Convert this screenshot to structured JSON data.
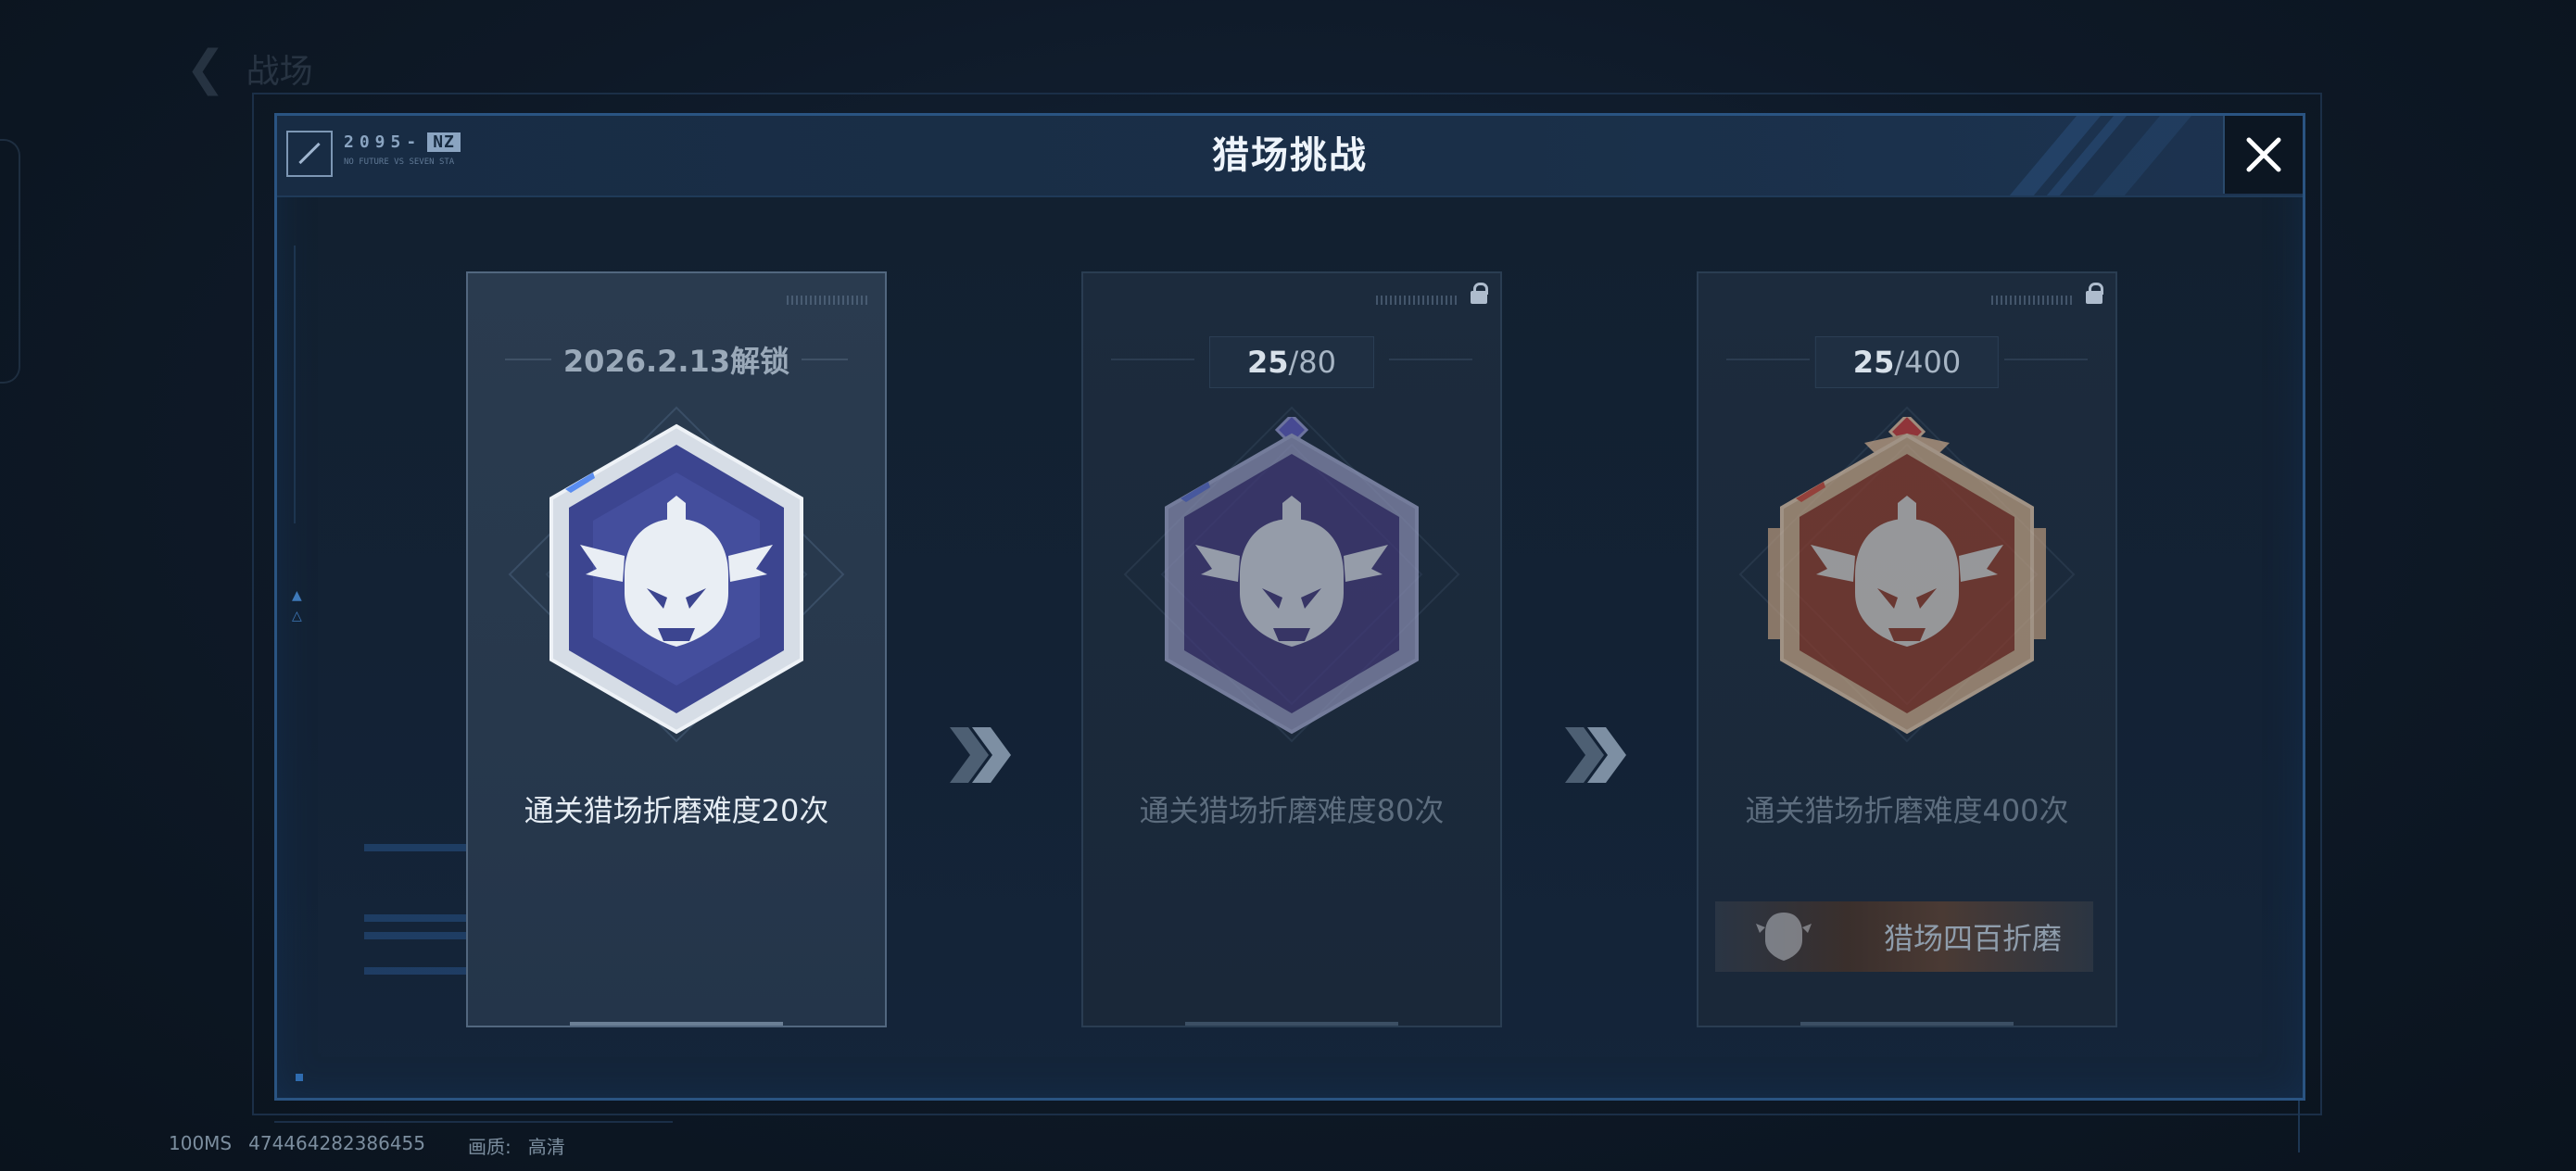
{
  "background": {
    "back_label": "战场"
  },
  "modal": {
    "title": "猎场挑战",
    "logo": {
      "line1": "2095-",
      "line1_badge": "NZ",
      "line2": "NO FUTURE VS SEVEN  STA"
    },
    "close_icon": "close-icon"
  },
  "cards": [
    {
      "state": "unlocked",
      "unlock_date": "2026.2.13解锁",
      "description": "通关猎场折磨难度20次",
      "badge_color": "#3c4590"
    },
    {
      "state": "locked",
      "progress_current": "25",
      "progress_total": "/80",
      "description": "通关猎场折磨难度80次",
      "badge_color": "#433b78"
    },
    {
      "state": "locked",
      "progress_current": "25",
      "progress_total": "/400",
      "description": "通关猎场折磨难度400次",
      "reward_name": "猎场四百折磨",
      "badge_color": "#8b3d2d"
    }
  ],
  "status_bar": {
    "latency": "100MS",
    "user_id": "474464282386455",
    "quality_label": "画质:",
    "quality_value": "高清"
  },
  "colors": {
    "accent_border": "#2a5482",
    "title_text": "#eef4fb"
  }
}
